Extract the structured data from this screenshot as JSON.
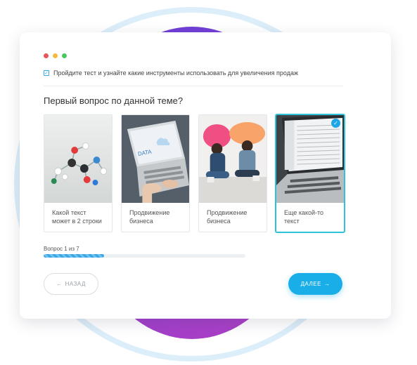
{
  "window": {
    "controls": [
      {
        "name": "close",
        "color": "#e9555a"
      },
      {
        "name": "minimize",
        "color": "#f2bc3a"
      },
      {
        "name": "maximize",
        "color": "#4dc561"
      }
    ]
  },
  "notice": {
    "checked": true,
    "text": "Пройдите тест и узнайте какие инструменты использовать для увеличения продаж"
  },
  "question": "Первый вопрос по данной теме?",
  "options": [
    {
      "label": "Какой текст может в 2 строки",
      "image": "molecule-model-photo",
      "selected": false
    },
    {
      "label": "Продвижение бизнеса",
      "image": "laptop-data-photo",
      "selected": false
    },
    {
      "label": "Продвижение бизнеса",
      "image": "people-with-speech-bubbles-photo",
      "selected": false
    },
    {
      "label": "Еще какой-то текст",
      "image": "laptop-spreadsheet-photo",
      "selected": true
    }
  ],
  "progress": {
    "label": "Вопрос 1 из 7",
    "fraction": 0.3
  },
  "buttons": {
    "back_label": "НАЗАД",
    "back_icon": "←",
    "next_label": "ДАЛЕЕ",
    "next_icon": "→"
  },
  "accent_color": "#1aaee8"
}
